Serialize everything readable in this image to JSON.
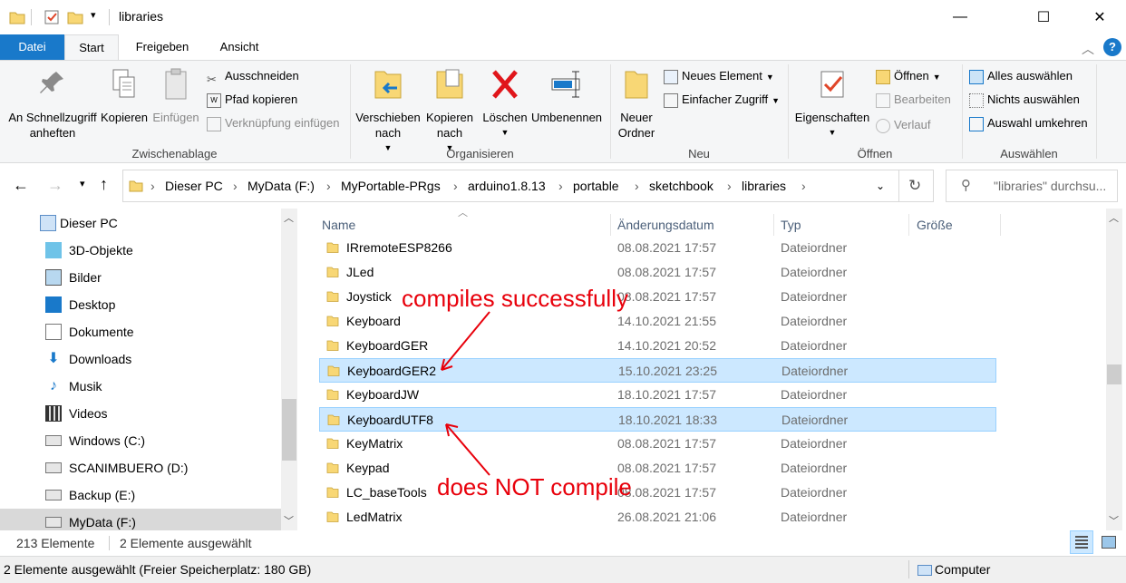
{
  "window": {
    "title": "libraries",
    "minimize": "—",
    "maximize": "☐",
    "close": "✕"
  },
  "tabs": [
    "Datei",
    "Start",
    "Freigeben",
    "Ansicht"
  ],
  "ribbon": {
    "clipboard": {
      "label": "Zwischenablage",
      "pin": "An Schnellzugriff anheften",
      "copy": "Kopieren",
      "paste": "Einfügen",
      "cut": "Ausschneiden",
      "copy_path": "Pfad kopieren",
      "paste_shortcut": "Verknüpfung einfügen"
    },
    "organize": {
      "label": "Organisieren",
      "move_to": "Verschieben nach",
      "copy_to": "Kopieren nach",
      "delete": "Löschen",
      "rename": "Umbenennen"
    },
    "new": {
      "label": "Neu",
      "new_folder": "Neuer Ordner",
      "new_item": "Neues Element",
      "easy_access": "Einfacher Zugriff"
    },
    "open": {
      "label": "Öffnen",
      "properties": "Eigenschaften",
      "open": "Öffnen",
      "edit": "Bearbeiten",
      "history": "Verlauf"
    },
    "select": {
      "label": "Auswählen",
      "select_all": "Alles auswählen",
      "select_none": "Nichts auswählen",
      "invert": "Auswahl umkehren"
    }
  },
  "address": {
    "crumbs": [
      "Dieser PC",
      "MyData (F:)",
      "MyPortable-PRgs",
      "arduino1.8.13",
      "portable",
      "sketchbook",
      "libraries"
    ],
    "search_placeholder": "\"libraries\" durchsu..."
  },
  "nav": [
    {
      "label": "Dieser PC",
      "icon": "computer-icon"
    },
    {
      "label": "3D-Objekte",
      "icon": "3d-objects-icon"
    },
    {
      "label": "Bilder",
      "icon": "pictures-icon"
    },
    {
      "label": "Desktop",
      "icon": "desktop-icon"
    },
    {
      "label": "Dokumente",
      "icon": "documents-icon"
    },
    {
      "label": "Downloads",
      "icon": "downloads-icon"
    },
    {
      "label": "Musik",
      "icon": "music-icon"
    },
    {
      "label": "Videos",
      "icon": "videos-icon"
    },
    {
      "label": "Windows (C:)",
      "icon": "drive-icon"
    },
    {
      "label": "SCANIMBUERO (D:)",
      "icon": "drive-icon"
    },
    {
      "label": "Backup (E:)",
      "icon": "drive-icon"
    },
    {
      "label": "MyData (F:)",
      "icon": "drive-icon"
    }
  ],
  "columns": [
    "Name",
    "Änderungsdatum",
    "Typ",
    "Größe"
  ],
  "files": [
    {
      "name": "IRremoteESP8266",
      "date": "08.08.2021 17:57",
      "type": "Dateiordner",
      "selected": false
    },
    {
      "name": "JLed",
      "date": "08.08.2021 17:57",
      "type": "Dateiordner",
      "selected": false
    },
    {
      "name": "Joystick",
      "date": "08.08.2021 17:57",
      "type": "Dateiordner",
      "selected": false
    },
    {
      "name": "Keyboard",
      "date": "14.10.2021 21:55",
      "type": "Dateiordner",
      "selected": false
    },
    {
      "name": "KeyboardGER",
      "date": "14.10.2021 20:52",
      "type": "Dateiordner",
      "selected": false
    },
    {
      "name": "KeyboardGER2",
      "date": "15.10.2021 23:25",
      "type": "Dateiordner",
      "selected": true
    },
    {
      "name": "KeyboardJW",
      "date": "18.10.2021 17:57",
      "type": "Dateiordner",
      "selected": false
    },
    {
      "name": "KeyboardUTF8",
      "date": "18.10.2021 18:33",
      "type": "Dateiordner",
      "selected": true
    },
    {
      "name": "KeyMatrix",
      "date": "08.08.2021 17:57",
      "type": "Dateiordner",
      "selected": false
    },
    {
      "name": "Keypad",
      "date": "08.08.2021 17:57",
      "type": "Dateiordner",
      "selected": false
    },
    {
      "name": "LC_baseTools",
      "date": "08.08.2021 17:57",
      "type": "Dateiordner",
      "selected": false
    },
    {
      "name": "LedMatrix",
      "date": "26.08.2021 21:06",
      "type": "Dateiordner",
      "selected": false
    }
  ],
  "status": {
    "count": "213 Elemente",
    "selected": "2 Elemente ausgewählt",
    "bottom_left": "2 Elemente ausgewählt (Freier Speicherplatz: 180 GB)",
    "bottom_right": "Computer"
  },
  "annotations": {
    "top": "compiles successfully",
    "bottom": "does NOT compile",
    "color": "#e8000b"
  },
  "colors": {
    "accent": "#1979ca",
    "selection": "#cce8ff",
    "folder": "#f8d775"
  }
}
